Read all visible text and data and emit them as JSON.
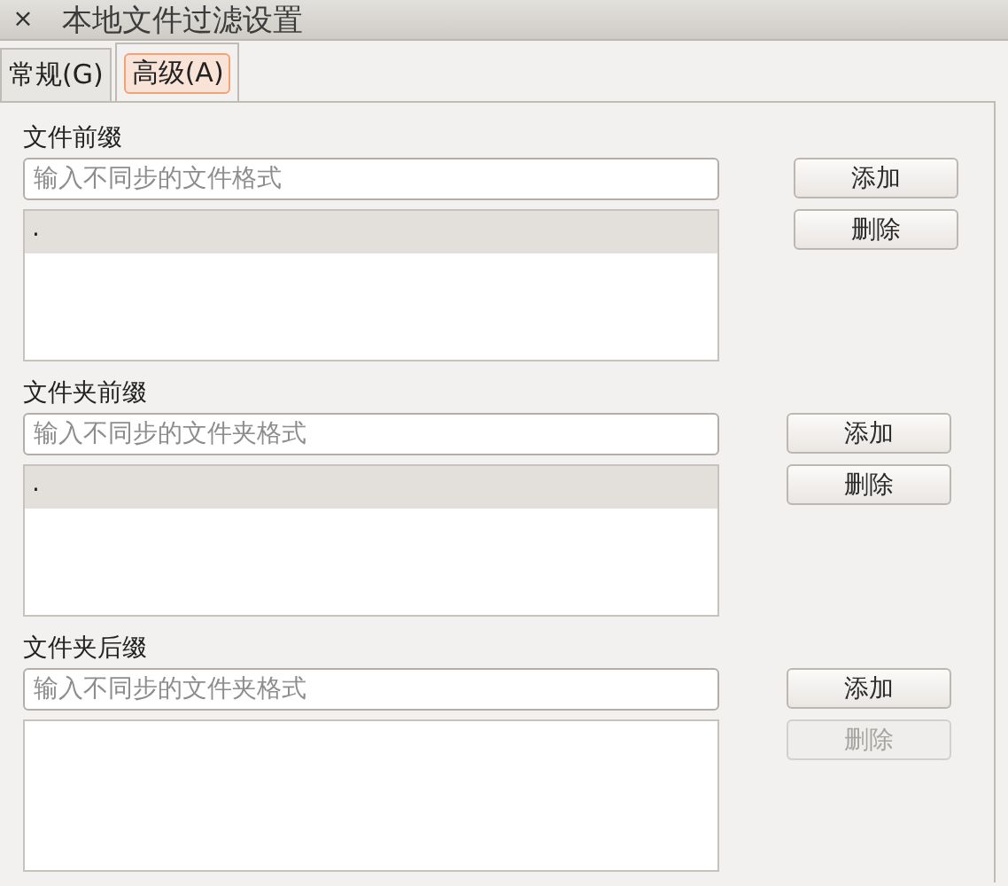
{
  "window": {
    "close": "×",
    "title": "本地文件过滤设置"
  },
  "tabs": [
    {
      "label": "常规(G)",
      "selected": false
    },
    {
      "label": "高级(A)",
      "selected": true
    }
  ],
  "sections": [
    {
      "label": "文件前缀",
      "placeholder": "输入不同步的文件格式",
      "items": [
        {
          "text": ".",
          "selected": true
        }
      ],
      "buttons": [
        {
          "label": "添加",
          "disabled": false
        },
        {
          "label": "删除",
          "disabled": false
        }
      ]
    },
    {
      "label": "文件夹前缀",
      "placeholder": "输入不同步的文件夹格式",
      "items": [
        {
          "text": ".",
          "selected": true
        }
      ],
      "buttons": [
        {
          "label": "添加",
          "disabled": false
        },
        {
          "label": "删除",
          "disabled": false
        }
      ]
    },
    {
      "label": "文件夹后缀",
      "placeholder": "输入不同步的文件夹格式",
      "buttons": [
        {
          "label": "添加",
          "disabled": false
        },
        {
          "label": "删除",
          "disabled": true
        }
      ]
    }
  ]
}
